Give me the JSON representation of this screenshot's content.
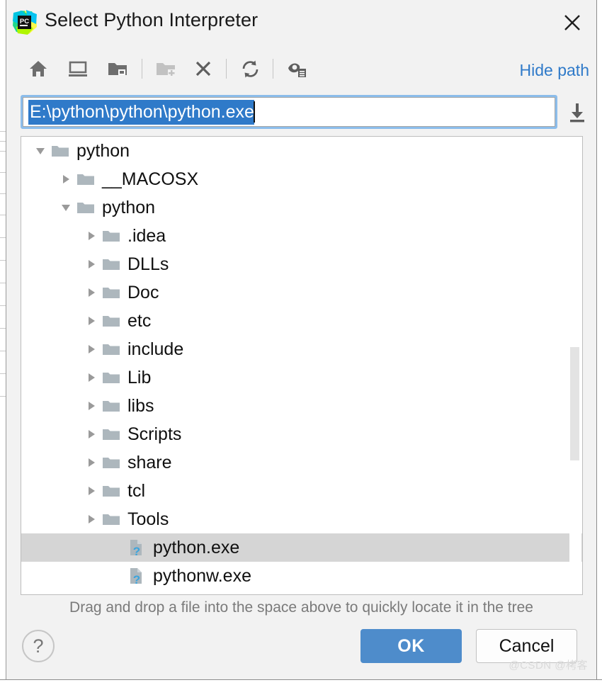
{
  "window": {
    "title": "Select Python Interpreter",
    "logo_icon": "pycharm-logo-icon",
    "close_icon": "close-icon"
  },
  "toolbar": {
    "buttons": [
      {
        "name": "home-icon",
        "tooltip": "Home",
        "disabled": false
      },
      {
        "name": "desktop-icon",
        "tooltip": "Desktop",
        "disabled": false
      },
      {
        "name": "folder-drive-icon",
        "tooltip": "Project directory",
        "disabled": false
      },
      {
        "name": "new-folder-icon",
        "tooltip": "New folder",
        "disabled": true
      },
      {
        "name": "delete-icon",
        "tooltip": "Delete",
        "disabled": false
      },
      {
        "name": "refresh-icon",
        "tooltip": "Refresh",
        "disabled": false
      },
      {
        "name": "show-hidden-files-icon",
        "tooltip": "Show hidden files and directories",
        "disabled": false
      }
    ],
    "hide_path_label": "Hide path"
  },
  "path_field": {
    "value": "E:\\python\\python\\python.exe",
    "selected": true,
    "download_icon": "download-icon",
    "accent_color": "#2f7ac9",
    "focus_border_color": "#8cbdeb"
  },
  "tree": {
    "rows": [
      {
        "label": "python",
        "depth": 1,
        "twist": "down",
        "icon": "folder-icon",
        "selected": false
      },
      {
        "label": "__MACOSX",
        "depth": 2,
        "twist": "right",
        "icon": "folder-icon",
        "selected": false
      },
      {
        "label": "python",
        "depth": 2,
        "twist": "down",
        "icon": "folder-icon",
        "selected": false
      },
      {
        "label": ".idea",
        "depth": 3,
        "twist": "right",
        "icon": "folder-icon",
        "selected": false
      },
      {
        "label": "DLLs",
        "depth": 3,
        "twist": "right",
        "icon": "folder-icon",
        "selected": false
      },
      {
        "label": "Doc",
        "depth": 3,
        "twist": "right",
        "icon": "folder-icon",
        "selected": false
      },
      {
        "label": "etc",
        "depth": 3,
        "twist": "right",
        "icon": "folder-icon",
        "selected": false
      },
      {
        "label": "include",
        "depth": 3,
        "twist": "right",
        "icon": "folder-icon",
        "selected": false
      },
      {
        "label": "Lib",
        "depth": 3,
        "twist": "right",
        "icon": "folder-icon",
        "selected": false
      },
      {
        "label": "libs",
        "depth": 3,
        "twist": "right",
        "icon": "folder-icon",
        "selected": false
      },
      {
        "label": "Scripts",
        "depth": 3,
        "twist": "right",
        "icon": "folder-icon",
        "selected": false
      },
      {
        "label": "share",
        "depth": 3,
        "twist": "right",
        "icon": "folder-icon",
        "selected": false
      },
      {
        "label": "tcl",
        "depth": 3,
        "twist": "right",
        "icon": "folder-icon",
        "selected": false
      },
      {
        "label": "Tools",
        "depth": 3,
        "twist": "right",
        "icon": "folder-icon",
        "selected": false
      },
      {
        "label": "python.exe",
        "depth": 4,
        "twist": "none",
        "icon": "unknown-file-icon",
        "selected": true
      },
      {
        "label": "pythonw.exe",
        "depth": 4,
        "twist": "none",
        "icon": "unknown-file-icon",
        "selected": false
      },
      {
        "label": "",
        "depth": 3,
        "twist": "right",
        "icon": "folder-icon",
        "selected": false
      }
    ],
    "selected_row_color": "#d5d5d5",
    "scrollbar": {
      "name": "vertical-scrollbar",
      "thumb_color": "#e3e3e3"
    }
  },
  "hint": {
    "text": "Drag and drop a file into the space above to quickly locate it in the tree"
  },
  "footer": {
    "help_label": "?",
    "ok_label": "OK",
    "cancel_label": "Cancel",
    "ok_color": "#4e8ccb"
  },
  "watermark": {
    "text": "@CSDN @栲客"
  }
}
